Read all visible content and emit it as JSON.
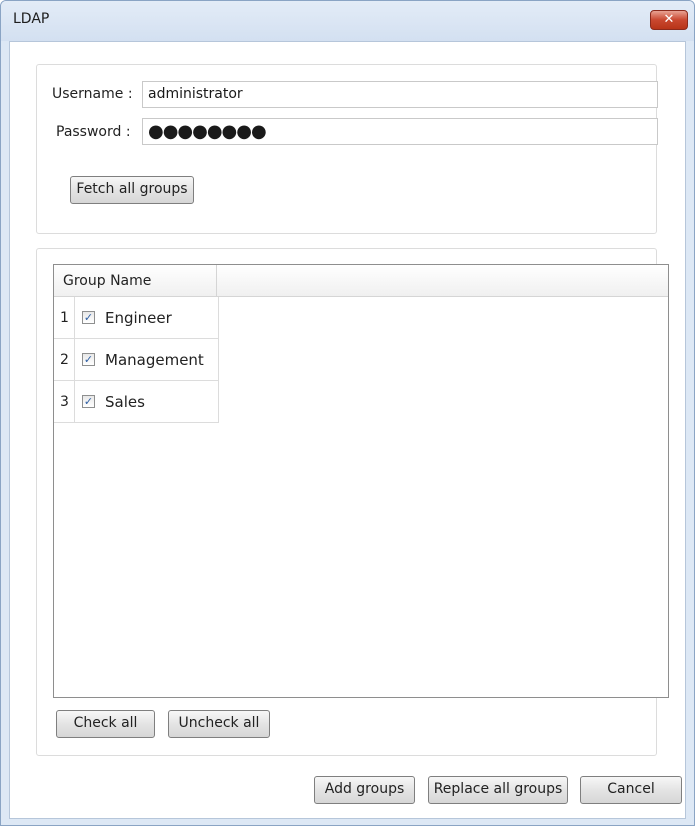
{
  "window": {
    "title": "LDAP",
    "close_glyph": "✕"
  },
  "login": {
    "username_label": "Username :",
    "username_value": "administrator",
    "password_label": "Password :",
    "password_value": "●●●●●●●●",
    "fetch_button": "Fetch all groups"
  },
  "groups": {
    "column_header": "Group Name",
    "rows": [
      {
        "index": "1",
        "checked": true,
        "check_glyph": "✓",
        "name": "Engineer"
      },
      {
        "index": "2",
        "checked": true,
        "check_glyph": "✓",
        "name": "Management"
      },
      {
        "index": "3",
        "checked": true,
        "check_glyph": "✓",
        "name": "Sales"
      }
    ],
    "check_all_button": "Check all",
    "uncheck_all_button": "Uncheck all"
  },
  "footer": {
    "add_groups_button": "Add groups",
    "replace_groups_button": "Replace all groups",
    "cancel_button": "Cancel"
  },
  "colors": {
    "accent": "#2f5fa3",
    "close_button": "#c9472f",
    "frame": "#dde8f5"
  }
}
